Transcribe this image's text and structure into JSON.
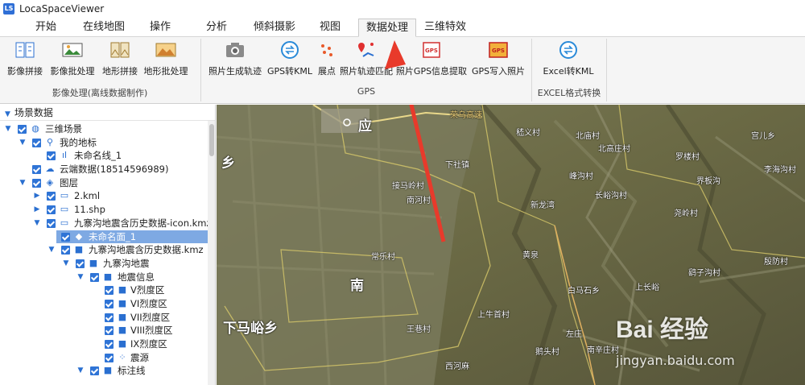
{
  "app": {
    "title": "LocaSpaceViewer",
    "icon_letter": "LS"
  },
  "menu": {
    "tabs": [
      "开始",
      "在线地图",
      "操作",
      "分析",
      "倾斜摄影",
      "视图",
      "数据处理",
      "三维特效"
    ],
    "active": "数据处理"
  },
  "ribbon": {
    "groups": [
      {
        "label": "影像处理(离线数据制作)",
        "buttons": [
          "影像拼接",
          "影像批处理",
          "地形拼接",
          "地形批处理"
        ]
      },
      {
        "label": "GPS",
        "buttons": [
          "照片生成轨迹",
          "GPS转KML",
          "展点",
          "照片轨迹匹配",
          "照片GPS信息提取",
          "GPS写入照片"
        ]
      },
      {
        "label": "EXCEL格式转换",
        "buttons": [
          "Excel转KML"
        ]
      }
    ]
  },
  "panel": {
    "title": "场景数据",
    "tree": [
      {
        "label": "三维场景",
        "icon": "globe-icon"
      },
      {
        "label": "我的地标",
        "icon": "pin-icon"
      },
      {
        "label": "未命名线_1",
        "icon": "chart-icon"
      },
      {
        "label": "云端数据(18514596989)",
        "icon": "cloud-icon"
      },
      {
        "label": "图层",
        "icon": "layers-icon"
      },
      {
        "label": "2.kml",
        "icon": "monitor-icon"
      },
      {
        "label": "11.shp",
        "icon": "monitor-icon"
      },
      {
        "label": "九寨沟地震含历史数据-icon.kmz",
        "icon": "monitor-icon"
      },
      {
        "label": "未命名面_1",
        "icon": "polygon-icon"
      },
      {
        "label": "九寨沟地震含历史数据.kmz",
        "icon": "folder-icon"
      },
      {
        "label": "九寨沟地震",
        "icon": "folder-icon"
      },
      {
        "label": "地震信息",
        "icon": "folder-icon"
      },
      {
        "label": "V烈度区",
        "icon": "square-icon"
      },
      {
        "label": "VI烈度区",
        "icon": "square-icon"
      },
      {
        "label": "VII烈度区",
        "icon": "square-icon"
      },
      {
        "label": "VIII烈度区",
        "icon": "square-icon"
      },
      {
        "label": "IX烈度区",
        "icon": "square-icon"
      },
      {
        "label": "震源",
        "icon": "dots-icon"
      },
      {
        "label": "标注线",
        "icon": "folder-icon"
      }
    ]
  },
  "map": {
    "labels": [
      "应",
      "下马峪乡",
      "南",
      "乡",
      "荣乌高速",
      "下社镇",
      "接马岭村",
      "南河村",
      "常乐村",
      "黄泉",
      "白马石乡",
      "上牛首村",
      "王巷村",
      "西河麻",
      "左庄",
      "南辛庄村",
      "鹅头村",
      "嵇义村",
      "北庙村",
      "北高庄村",
      "罗楼村",
      "宫儿乡",
      "峰沟村",
      "界板沟",
      "李海沟村",
      "长峪沟村",
      "新龙湾",
      "尧岭村",
      "鹞子沟村",
      "殷防村",
      "上长峪"
    ],
    "watermark_main": "Bai 经验",
    "watermark_url": "jingyan.baidu.com"
  },
  "colors": {
    "accent": "#2a6fd0",
    "checkbox": "#2f74d6",
    "selection": "#7ea9e3",
    "arrow": "#e83a2b"
  }
}
